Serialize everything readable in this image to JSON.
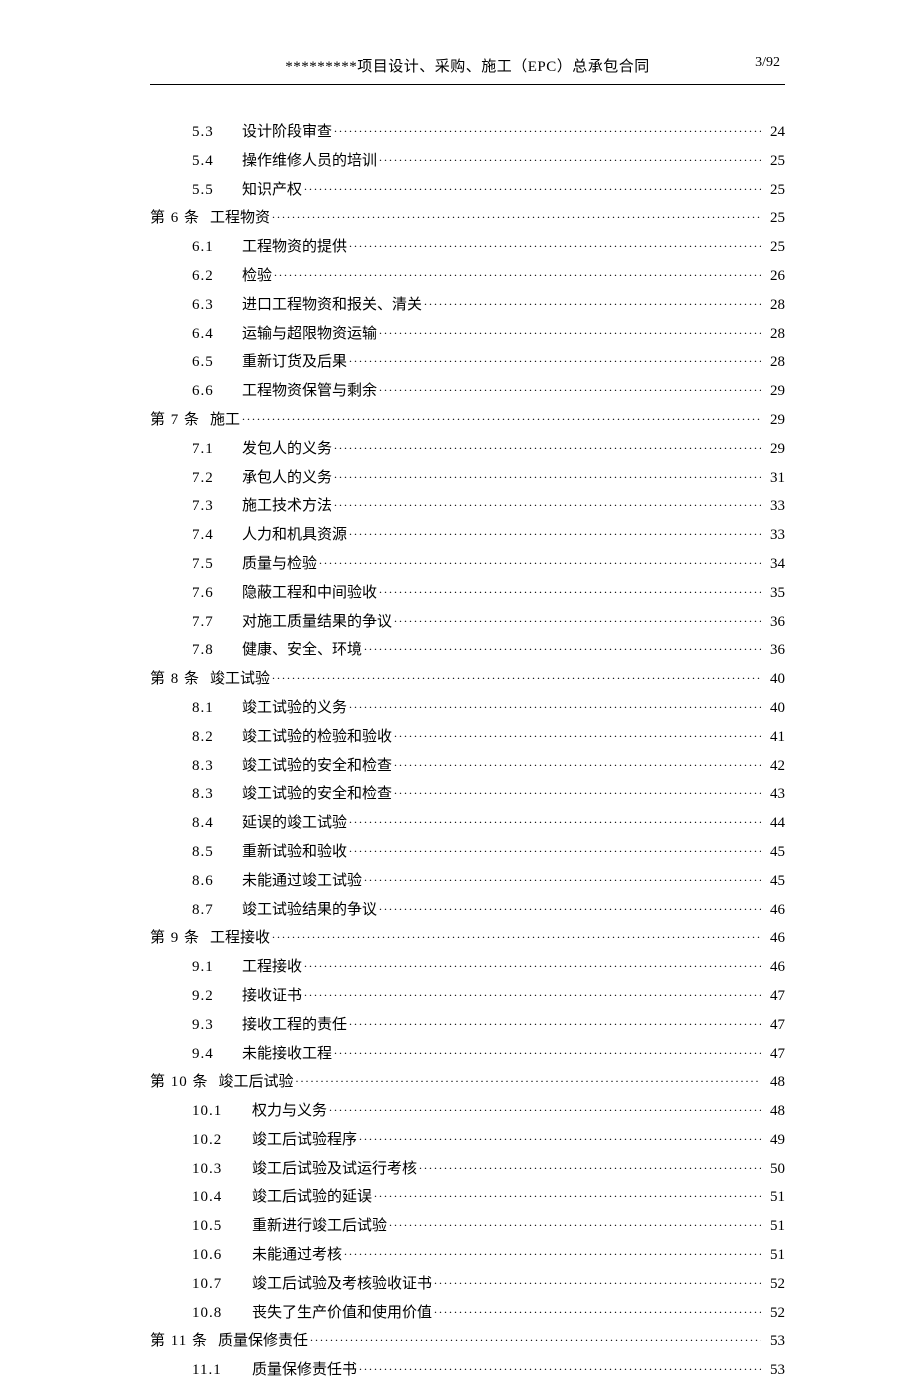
{
  "header": {
    "title": "*********项目设计、采购、施工（EPC）总承包合同",
    "page": "3/92"
  },
  "toc": [
    {
      "level": "sub",
      "num": "5.3",
      "label": "设计阶段审查",
      "page": "24"
    },
    {
      "level": "sub",
      "num": "5.4",
      "label": "操作维修人员的培训",
      "page": "25"
    },
    {
      "level": "sub",
      "num": "5.5",
      "label": "知识产权",
      "page": "25"
    },
    {
      "level": "top",
      "num": "第 6 条",
      "label": "工程物资",
      "page": "25"
    },
    {
      "level": "sub",
      "num": "6.1",
      "label": "工程物资的提供",
      "page": "25"
    },
    {
      "level": "sub",
      "num": "6.2",
      "label": "检验",
      "page": "26"
    },
    {
      "level": "sub",
      "num": "6.3",
      "label": "进口工程物资和报关、清关",
      "page": "28"
    },
    {
      "level": "sub",
      "num": "6.4",
      "label": "运输与超限物资运输",
      "page": "28"
    },
    {
      "level": "sub",
      "num": "6.5",
      "label": "重新订货及后果",
      "page": "28"
    },
    {
      "level": "sub",
      "num": "6.6",
      "label": "工程物资保管与剩余",
      "page": "29"
    },
    {
      "level": "top",
      "num": "第 7 条",
      "label": "施工",
      "page": "29"
    },
    {
      "level": "sub",
      "num": "7.1",
      "label": "发包人的义务",
      "page": "29"
    },
    {
      "level": "sub",
      "num": "7.2",
      "label": "承包人的义务",
      "page": "31"
    },
    {
      "level": "sub",
      "num": "7.3",
      "label": "施工技术方法",
      "page": "33"
    },
    {
      "level": "sub",
      "num": "7.4",
      "label": "人力和机具资源",
      "page": "33"
    },
    {
      "level": "sub",
      "num": "7.5",
      "label": "质量与检验",
      "page": "34"
    },
    {
      "level": "sub",
      "num": "7.6",
      "label": "隐蔽工程和中间验收",
      "page": "35"
    },
    {
      "level": "sub",
      "num": "7.7",
      "label": "对施工质量结果的争议",
      "page": "36"
    },
    {
      "level": "sub",
      "num": "7.8",
      "label": "健康、安全、环境",
      "page": "36"
    },
    {
      "level": "top",
      "num": "第 8 条",
      "label": "竣工试验",
      "page": "40"
    },
    {
      "level": "sub",
      "num": "8.1",
      "label": "竣工试验的义务",
      "page": "40"
    },
    {
      "level": "sub",
      "num": "8.2",
      "label": "竣工试验的检验和验收",
      "page": "41"
    },
    {
      "level": "sub",
      "num": "8.3",
      "label": "竣工试验的安全和检查",
      "page": "42"
    },
    {
      "level": "sub",
      "num": "8.3",
      "label": "竣工试验的安全和检查",
      "page": "43"
    },
    {
      "level": "sub",
      "num": "8.4",
      "label": "延误的竣工试验",
      "page": "44"
    },
    {
      "level": "sub",
      "num": "8.5",
      "label": "重新试验和验收",
      "page": "45"
    },
    {
      "level": "sub",
      "num": "8.6",
      "label": "未能通过竣工试验",
      "page": "45"
    },
    {
      "level": "sub",
      "num": "8.7",
      "label": "竣工试验结果的争议",
      "page": "46"
    },
    {
      "level": "top",
      "num": "第 9 条",
      "label": "工程接收",
      "page": "46"
    },
    {
      "level": "sub",
      "num": "9.1",
      "label": "工程接收",
      "page": "46"
    },
    {
      "level": "sub",
      "num": "9.2",
      "label": "接收证书",
      "page": "47"
    },
    {
      "level": "sub",
      "num": "9.3",
      "label": "接收工程的责任",
      "page": "47"
    },
    {
      "level": "sub",
      "num": "9.4",
      "label": "未能接收工程",
      "page": "47"
    },
    {
      "level": "top",
      "num": "第 10 条",
      "label": "竣工后试验",
      "page": "48"
    },
    {
      "level": "sub",
      "num": "10.1",
      "label": "权力与义务",
      "page": "48",
      "wide": true
    },
    {
      "level": "sub",
      "num": "10.2",
      "label": "竣工后试验程序",
      "page": "49",
      "wide": true
    },
    {
      "level": "sub",
      "num": "10.3",
      "label": "竣工后试验及试运行考核",
      "page": "50",
      "wide": true
    },
    {
      "level": "sub",
      "num": "10.4",
      "label": "竣工后试验的延误",
      "page": "51",
      "wide": true
    },
    {
      "level": "sub",
      "num": "10.5",
      "label": "重新进行竣工后试验",
      "page": "51",
      "wide": true
    },
    {
      "level": "sub",
      "num": "10.6",
      "label": "未能通过考核",
      "page": "51",
      "wide": true
    },
    {
      "level": "sub",
      "num": "10.7",
      "label": "竣工后试验及考核验收证书",
      "page": "52",
      "wide": true
    },
    {
      "level": "sub",
      "num": "10.8",
      "label": "丧失了生产价值和使用价值",
      "page": "52",
      "wide": true
    },
    {
      "level": "top",
      "num": "第 11 条",
      "label": "质量保修责任",
      "page": "53"
    },
    {
      "level": "sub",
      "num": "11.1",
      "label": "质量保修责任书",
      "page": "53",
      "wide": true
    }
  ]
}
